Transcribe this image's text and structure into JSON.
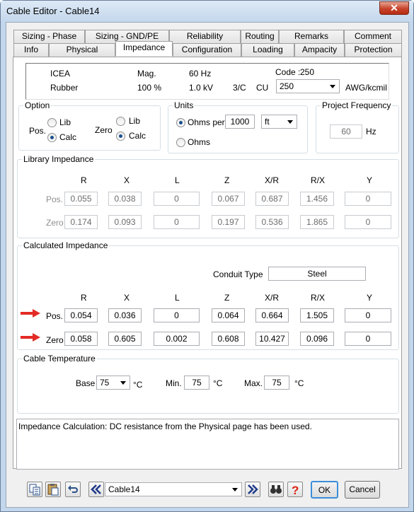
{
  "window": {
    "title": "Cable Editor - Cable14",
    "close": "✕"
  },
  "tabs_row1": [
    "Sizing - Phase",
    "Sizing - GND/PE",
    "Reliability",
    "Routing",
    "Remarks",
    "Comment"
  ],
  "tabs_row2": [
    "Info",
    "Physical",
    "Impedance",
    "Configuration",
    "Loading",
    "Ampacity",
    "Protection"
  ],
  "info": {
    "std": "ICEA",
    "mag_label": "Mag.",
    "freq": "60 Hz",
    "code_label": "Code :",
    "code": "250",
    "insul": "Rubber",
    "pct": "100 %",
    "kv": "1.0 kV",
    "cond": "3/C",
    "metal": "CU",
    "size": "250",
    "unit": "AWG/kcmil"
  },
  "option": {
    "title": "Option",
    "pos": "Pos.",
    "zero": "Zero",
    "lib": "Lib",
    "calc": "Calc"
  },
  "units": {
    "title": "Units",
    "ohms_per": "Ohms per",
    "length": "1000",
    "unit": "ft",
    "ohms": "Ohms"
  },
  "freq": {
    "title": "Project Frequency",
    "value": "60",
    "unit": "Hz"
  },
  "cols": [
    "R",
    "X",
    "L",
    "Z",
    "X/R",
    "R/X",
    "Y"
  ],
  "lib": {
    "title": "Library Impedance",
    "pos_label": "Pos.",
    "zero_label": "Zero",
    "pos": [
      "0.055",
      "0.038",
      "0",
      "0.067",
      "0.687",
      "1.456",
      "0"
    ],
    "zero": [
      "0.174",
      "0.093",
      "0",
      "0.197",
      "0.536",
      "1.865",
      "0"
    ]
  },
  "calc": {
    "title": "Calculated Impedance",
    "conduit_label": "Conduit Type",
    "conduit": "Steel",
    "pos_label": "Pos.",
    "zero_label": "Zero",
    "pos": [
      "0.054",
      "0.036",
      "0",
      "0.064",
      "0.664",
      "1.505",
      "0"
    ],
    "zero": [
      "0.058",
      "0.605",
      "0.002",
      "0.608",
      "10.427",
      "0.096",
      "0"
    ]
  },
  "temp": {
    "title": "Cable Temperature",
    "base_label": "Base",
    "base": "75",
    "unit": "°C",
    "min_label": "Min.",
    "min": "75",
    "max_label": "Max.",
    "max": "75"
  },
  "message": "Impedance Calculation: DC resistance from the Physical page has been used.",
  "bottom": {
    "cable": "Cable14",
    "ok": "OK",
    "cancel": "Cancel"
  },
  "colors": {
    "accent": "#e32b25",
    "titlebar": "#c4d7ec"
  }
}
